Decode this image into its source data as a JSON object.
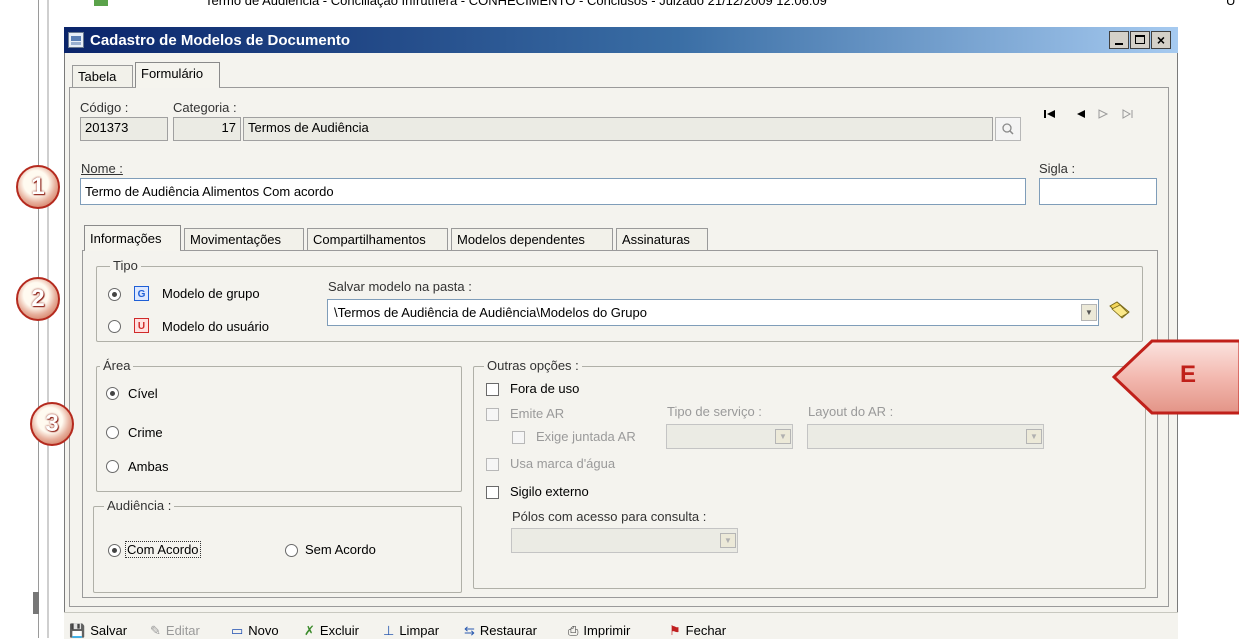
{
  "background_window": {
    "row_text": "Termo de Audiência - Conciliação Infrutífera - CONHECIMENTO - Conclusos - Juizado  21/12/2009 12:06:09",
    "right_fragment": "U"
  },
  "window": {
    "title": "Cadastro de Modelos de Documento",
    "controls": [
      "_",
      "□",
      "×"
    ]
  },
  "main_tabs": [
    {
      "label": "Tabela",
      "active": false
    },
    {
      "label": "Formulário",
      "active": true
    }
  ],
  "form": {
    "codigo_label": "Código :",
    "codigo_value": "201373",
    "categoria_label": "Categoria :",
    "categoria_code": "17",
    "categoria_name": "Termos de Audiência",
    "nome_label": "Nome :",
    "nome_value": "Termo de Audiência Alimentos Com acordo",
    "sigla_label": "Sigla :",
    "sigla_value": ""
  },
  "nav_icons": [
    "first-record-icon",
    "previous-record-icon",
    "next-record-icon",
    "last-record-icon"
  ],
  "sub_tabs": [
    {
      "label": "Informações",
      "active": true
    },
    {
      "label": "Movimentações",
      "active": false
    },
    {
      "label": "Compartilhamentos",
      "active": false
    },
    {
      "label": "Modelos dependentes",
      "active": false
    },
    {
      "label": "Assinaturas",
      "active": false
    }
  ],
  "tipo": {
    "title": "Tipo",
    "options": [
      {
        "label": "Modelo de grupo",
        "badge": "G",
        "badge_color": "#1f5fd6",
        "selected": true
      },
      {
        "label": "Modelo do usuário",
        "badge": "U",
        "badge_color": "#d02a2a",
        "selected": false
      }
    ],
    "pasta_label": "Salvar modelo na pasta :",
    "pasta_value": "\\Termos de Audiência de Audiência\\Modelos do Grupo"
  },
  "area": {
    "title": "Área",
    "options": [
      {
        "label": "Cível",
        "selected": true
      },
      {
        "label": "Crime",
        "selected": false
      },
      {
        "label": "Ambas",
        "selected": false
      }
    ]
  },
  "audiencia": {
    "title": "Audiência :",
    "options": [
      {
        "label": "Com Acordo",
        "selected": true
      },
      {
        "label": "Sem Acordo",
        "selected": false
      }
    ]
  },
  "outras": {
    "title": "Outras opções :",
    "fora_de_uso": "Fora de uso",
    "emite_ar": "Emite AR",
    "exige_juntada": "Exige juntada AR",
    "usa_marca": "Usa marca d'água",
    "sigilo": "Sigilo externo",
    "tipo_servico_label": "Tipo de serviço :",
    "layout_ar_label": "Layout do AR :",
    "polos_label": "Pólos com acesso para consulta :"
  },
  "callouts": {
    "one": "1",
    "two": "2",
    "three": "3",
    "arrow": "E"
  },
  "toolbar": [
    {
      "label": "Salvar",
      "enabled": true
    },
    {
      "label": "Editar",
      "enabled": false
    },
    {
      "label": "Novo",
      "enabled": true
    },
    {
      "label": "Excluir",
      "enabled": true
    },
    {
      "label": "Limpar",
      "enabled": true
    },
    {
      "label": "Restaurar",
      "enabled": true
    },
    {
      "label": "Imprimir",
      "enabled": true
    },
    {
      "label": "Fechar",
      "enabled": true
    }
  ],
  "colors": {
    "titlebar_start": "#0a246a",
    "titlebar_end": "#a6caf0",
    "callout_red": "#c0201a",
    "panel": "#f4f3ee"
  }
}
